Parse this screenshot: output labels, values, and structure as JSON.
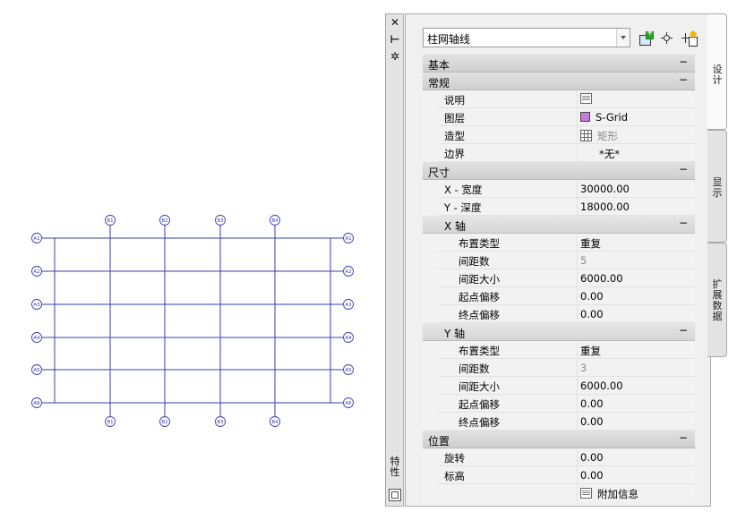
{
  "drawing": {
    "bubble_labels": {
      "top": [
        "B1",
        "B2",
        "B3",
        "B4"
      ],
      "bottom": [
        "B1",
        "B2",
        "B3",
        "B4"
      ],
      "left": [
        "A1",
        "A2",
        "A3",
        "A4",
        "A5",
        "A6"
      ],
      "right": [
        "A1",
        "A2",
        "A3",
        "A4",
        "A5",
        "A6"
      ]
    },
    "line_color": "#3b3bb0"
  },
  "titlebar": {
    "close_glyph": "✕",
    "autohide_glyph": "⊢",
    "settings_glyph": "✲",
    "vertical_title": "特性"
  },
  "toolbar": {
    "style_value": "柱网轴线",
    "icons": [
      "add-style-icon",
      "pick-point-icon",
      "quick-select-icon"
    ]
  },
  "tabs": [
    {
      "label": "设计",
      "active": true
    },
    {
      "label": "显示",
      "active": false
    },
    {
      "label": "扩展数据",
      "active": false
    }
  ],
  "props": {
    "cat_basic": {
      "label": "基本",
      "toggle": "−"
    },
    "cat_general": {
      "label": "常规",
      "toggle": "−"
    },
    "desc": {
      "label": "说明"
    },
    "layer": {
      "label": "图层",
      "value": "S-Grid",
      "color": "#c37bdc"
    },
    "shape": {
      "label": "造型",
      "value": "矩形"
    },
    "boundary": {
      "label": "边界",
      "value": "*无*"
    },
    "cat_dim": {
      "label": "尺寸",
      "toggle": "−"
    },
    "x_width": {
      "label": "X - 宽度",
      "value": "30000.00"
    },
    "y_depth": {
      "label": "Y - 深度",
      "value": "18000.00"
    },
    "x_axis": {
      "label": "X 轴",
      "toggle": "−",
      "layout_type": {
        "label": "布置类型",
        "value": "重复"
      },
      "bay_count": {
        "label": "间距数",
        "value": "5"
      },
      "bay_size": {
        "label": "间距大小",
        "value": "6000.00"
      },
      "start_offset": {
        "label": "起点偏移",
        "value": "0.00"
      },
      "end_offset": {
        "label": "终点偏移",
        "value": "0.00"
      }
    },
    "y_axis": {
      "label": "Y 轴",
      "toggle": "−",
      "layout_type": {
        "label": "布置类型",
        "value": "重复"
      },
      "bay_count": {
        "label": "间距数",
        "value": "3"
      },
      "bay_size": {
        "label": "间距大小",
        "value": "6000.00"
      },
      "start_offset": {
        "label": "起点偏移",
        "value": "0.00"
      },
      "end_offset": {
        "label": "终点偏移",
        "value": "0.00"
      }
    },
    "cat_location": {
      "label": "位置",
      "toggle": "−"
    },
    "rotation": {
      "label": "旋转",
      "value": "0.00"
    },
    "elevation": {
      "label": "标高",
      "value": "0.00"
    },
    "extra_info": {
      "value": "附加信息"
    }
  }
}
